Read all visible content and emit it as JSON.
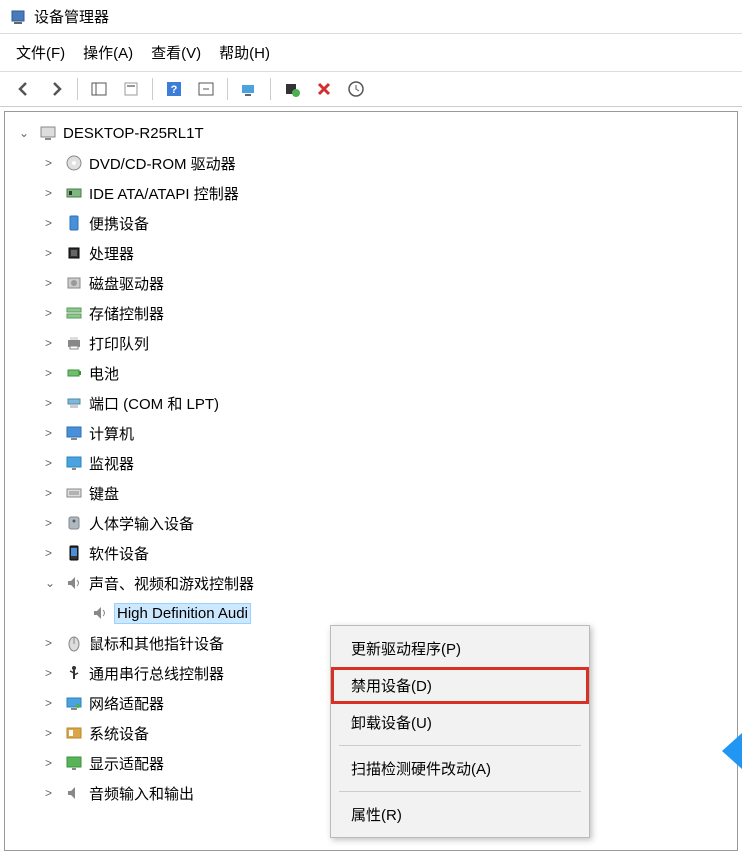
{
  "window": {
    "title": "设备管理器"
  },
  "menu": {
    "file": "文件(F)",
    "action": "操作(A)",
    "view": "查看(V)",
    "help": "帮助(H)"
  },
  "tree": {
    "root": "DESKTOP-R25RL1T",
    "categories": [
      {
        "label": "DVD/CD-ROM 驱动器",
        "icon": "disc"
      },
      {
        "label": "IDE ATA/ATAPI 控制器",
        "icon": "ide"
      },
      {
        "label": "便携设备",
        "icon": "portable"
      },
      {
        "label": "处理器",
        "icon": "cpu"
      },
      {
        "label": "磁盘驱动器",
        "icon": "disk"
      },
      {
        "label": "存储控制器",
        "icon": "storage"
      },
      {
        "label": "打印队列",
        "icon": "printer"
      },
      {
        "label": "电池",
        "icon": "battery"
      },
      {
        "label": "端口 (COM 和 LPT)",
        "icon": "port"
      },
      {
        "label": "计算机",
        "icon": "computer"
      },
      {
        "label": "监视器",
        "icon": "monitor"
      },
      {
        "label": "键盘",
        "icon": "keyboard"
      },
      {
        "label": "人体学输入设备",
        "icon": "hid"
      },
      {
        "label": "软件设备",
        "icon": "software"
      },
      {
        "label": "声音、视频和游戏控制器",
        "icon": "sound",
        "expanded": true
      },
      {
        "label": "鼠标和其他指针设备",
        "icon": "mouse"
      },
      {
        "label": "通用串行总线控制器",
        "icon": "usb"
      },
      {
        "label": "网络适配器",
        "icon": "network"
      },
      {
        "label": "系统设备",
        "icon": "system"
      },
      {
        "label": "显示适配器",
        "icon": "display"
      },
      {
        "label": "音频输入和输出",
        "icon": "audio"
      }
    ],
    "selected_device": "High Definition Audi"
  },
  "context_menu": {
    "update": "更新驱动程序(P)",
    "disable": "禁用设备(D)",
    "uninstall": "卸载设备(U)",
    "scan": "扫描检测硬件改动(A)",
    "properties": "属性(R)"
  }
}
